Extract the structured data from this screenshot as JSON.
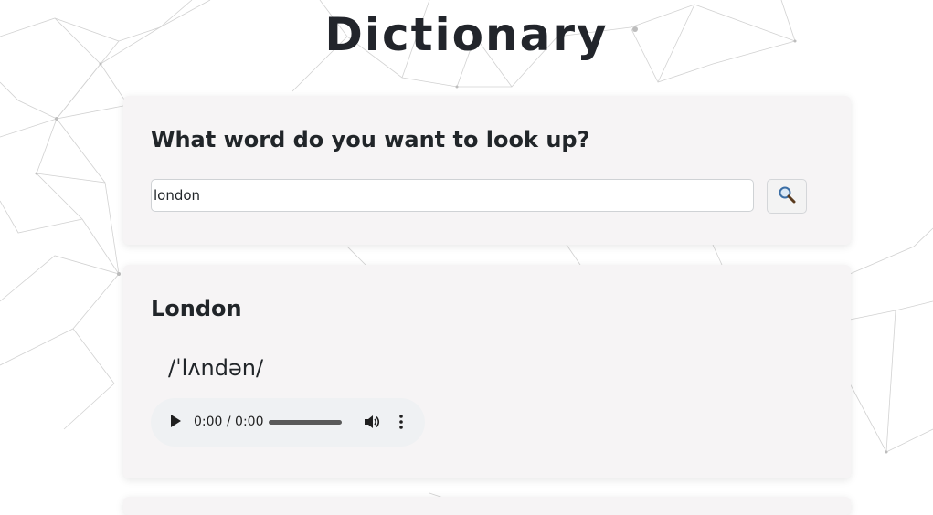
{
  "app": {
    "title": "Dictionary"
  },
  "search": {
    "question": "What word do you want to look up?",
    "value": "london",
    "button_icon": "magnifier-icon"
  },
  "result": {
    "word": "London",
    "phonetic": "/ˈlʌndən/",
    "audio": {
      "time": "0:00 / 0:00",
      "play_icon": "play-icon",
      "volume_icon": "volume-icon",
      "menu_icon": "more-vert-icon"
    }
  },
  "colors": {
    "card_background": "#f6f4f5",
    "page_background": "#ffffff",
    "text": "#212529"
  }
}
